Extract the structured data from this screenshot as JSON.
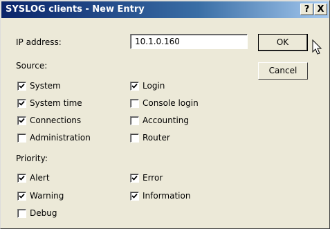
{
  "window": {
    "title": "SYSLOG clients - New Entry",
    "help_label": "?",
    "close_label": "X"
  },
  "ip": {
    "label": "IP address:",
    "value": "10.1.0.160"
  },
  "buttons": {
    "ok": "OK",
    "cancel": "Cancel"
  },
  "source": {
    "heading": "Source:",
    "items": [
      {
        "label": "System",
        "checked": true
      },
      {
        "label": "Login",
        "checked": true
      },
      {
        "label": "System time",
        "checked": true
      },
      {
        "label": "Console login",
        "checked": false
      },
      {
        "label": "Connections",
        "checked": true
      },
      {
        "label": "Accounting",
        "checked": false
      },
      {
        "label": "Administration",
        "checked": false
      },
      {
        "label": "Router",
        "checked": false
      }
    ]
  },
  "priority": {
    "heading": "Priority:",
    "items": [
      {
        "label": "Alert",
        "checked": true
      },
      {
        "label": "Error",
        "checked": true
      },
      {
        "label": "Warning",
        "checked": true
      },
      {
        "label": "Information",
        "checked": true
      },
      {
        "label": "Debug",
        "checked": false
      }
    ]
  }
}
